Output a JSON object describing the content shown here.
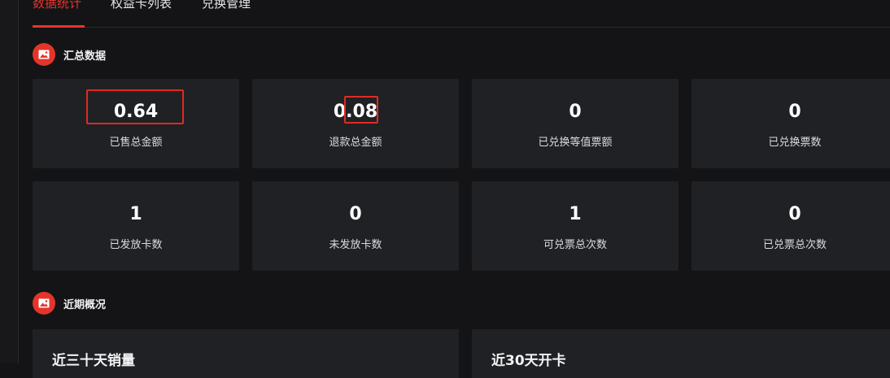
{
  "tabs": [
    {
      "label": "数据统计",
      "active": true
    },
    {
      "label": "权益卡列表",
      "active": false
    },
    {
      "label": "兑换管理",
      "active": false
    }
  ],
  "summary": {
    "title": "汇总数据",
    "icon": "image-icon",
    "cards": [
      {
        "value": "0.64",
        "label": "已售总金额"
      },
      {
        "value": "0.08",
        "label": "退款总金额"
      },
      {
        "value": "0",
        "label": "已兑换等值票额"
      },
      {
        "value": "0",
        "label": "已兑换票数"
      },
      {
        "value": "1",
        "label": "已发放卡数"
      },
      {
        "value": "0",
        "label": "未发放卡数"
      },
      {
        "value": "1",
        "label": "可兑票总次数"
      },
      {
        "value": "0",
        "label": "已兑票总次数"
      }
    ]
  },
  "recent": {
    "title": "近期概况",
    "icon": "image-icon",
    "panels": [
      {
        "title": "近三十天销量"
      },
      {
        "title": "近30天开卡"
      }
    ]
  },
  "colors": {
    "accent": "#e5352b",
    "background": "#141416",
    "card": "#202124",
    "highlight_box": "#e02a22"
  }
}
